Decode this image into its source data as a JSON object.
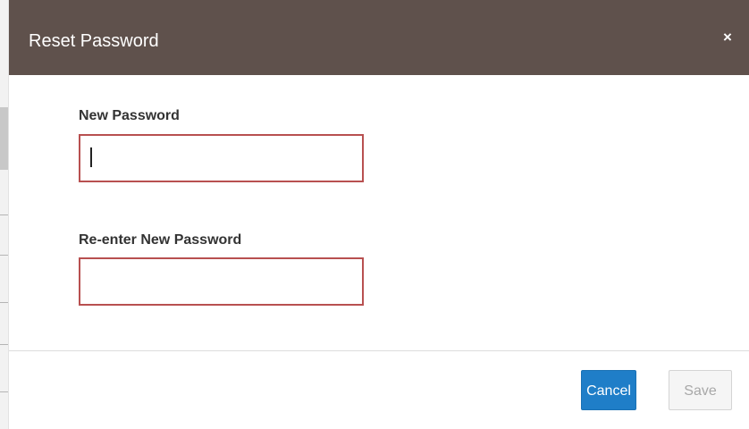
{
  "dialog": {
    "title": "Reset Password",
    "close_label": "×"
  },
  "form": {
    "new_password": {
      "label": "New Password",
      "value": "",
      "placeholder": ""
    },
    "confirm_password": {
      "label": "Re-enter New Password",
      "value": "",
      "placeholder": ""
    }
  },
  "footer": {
    "cancel_label": "Cancel",
    "save_label": "Save"
  },
  "colors": {
    "header_bg": "#5f514c",
    "input_error_border": "#b85050",
    "primary_button": "#1f7ec8",
    "disabled_button_text": "#a8a8a8"
  },
  "icons": {
    "close": "close-icon",
    "caret": "text-cursor"
  }
}
